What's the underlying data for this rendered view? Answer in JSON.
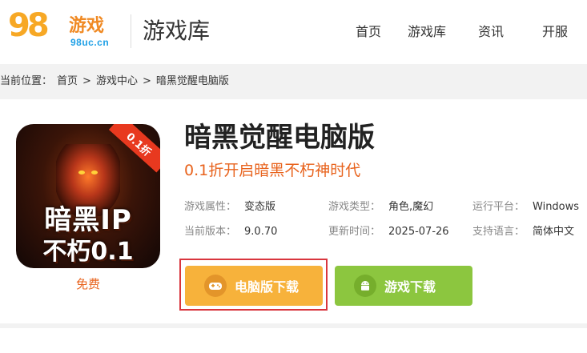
{
  "header": {
    "logo": {
      "number": "98",
      "cn": "游戏",
      "url": "98uc.cn"
    },
    "section_title": "游戏库",
    "nav": [
      "首页",
      "游戏库",
      "资讯",
      "开服"
    ]
  },
  "breadcrumb": {
    "prefix": "当前位置：",
    "items": [
      "首页",
      "游戏中心",
      "暗黑觉醒电脑版"
    ],
    "separator": ">"
  },
  "game": {
    "icon_ribbon": "0.1折",
    "icon_title_line1": "暗黑IP",
    "icon_title_line2": "不朽0.1",
    "price": "免费",
    "title": "暗黑觉醒电脑版",
    "slogan": "0.1折开启暗黑不朽神时代",
    "info": [
      {
        "label": "游戏属性：",
        "value": "变态版"
      },
      {
        "label": "游戏类型：",
        "value": "角色,魔幻"
      },
      {
        "label": "运行平台：",
        "value": "Windows"
      },
      {
        "label": "当前版本：",
        "value": "9.0.70"
      },
      {
        "label": "更新时间：",
        "value": "2025-07-26"
      },
      {
        "label": "支持语言：",
        "value": "简体中文"
      }
    ]
  },
  "buttons": {
    "pc_download": "电脑版下载",
    "game_download": "游戏下载"
  },
  "colors": {
    "accent_orange": "#e8631d",
    "pc_button": "#f7b23b",
    "game_button": "#8cc63f",
    "highlight_frame": "#d9363e"
  }
}
